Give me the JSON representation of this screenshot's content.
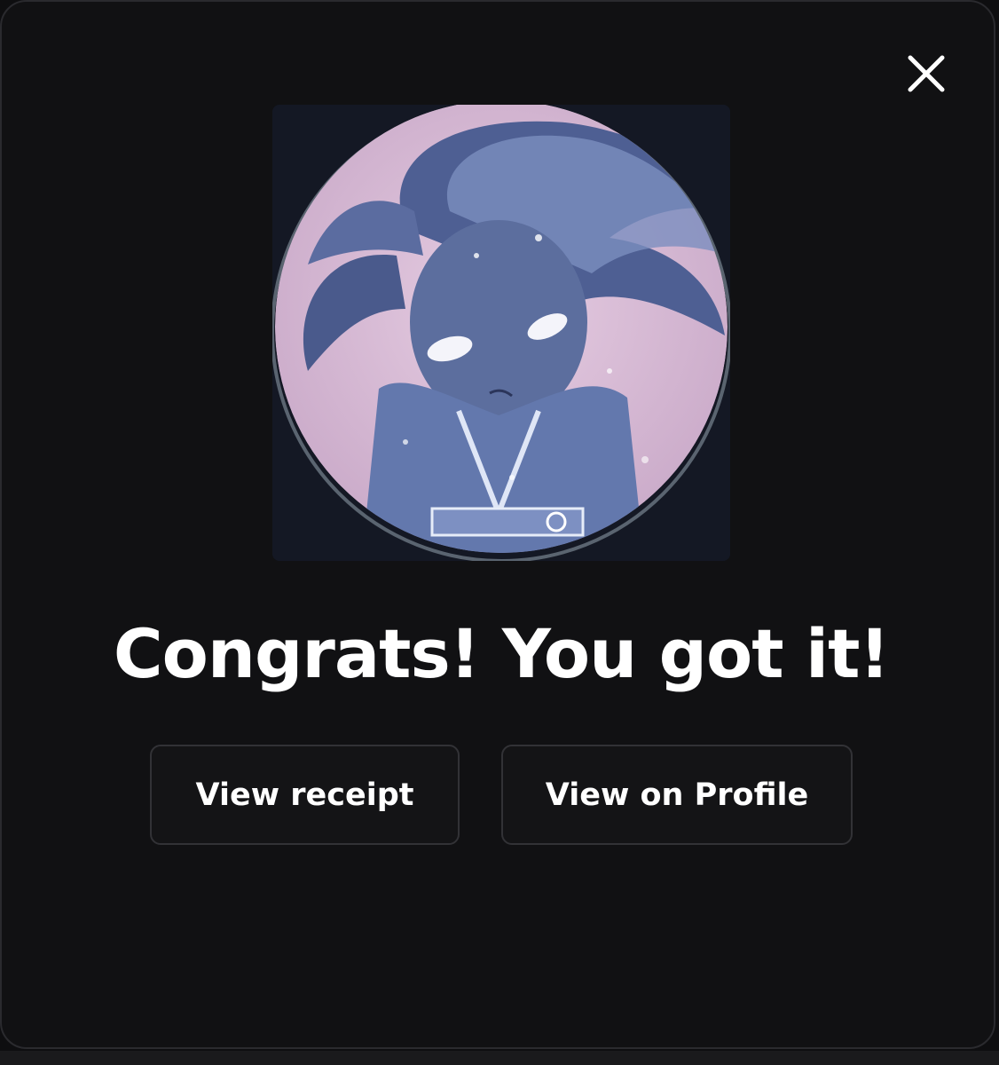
{
  "dialog": {
    "close_icon": "close-icon",
    "artwork_icon": "nft-artwork-image",
    "headline": "Congrats! You got it!",
    "buttons": {
      "view_receipt": "View receipt",
      "view_on_profile": "View on Profile"
    }
  },
  "colors": {
    "background": "#111113",
    "text": "#ffffff",
    "button_border": "#323236",
    "artwork_circle": "#d9bfd6",
    "artwork_figure": "#5c6e9e"
  }
}
